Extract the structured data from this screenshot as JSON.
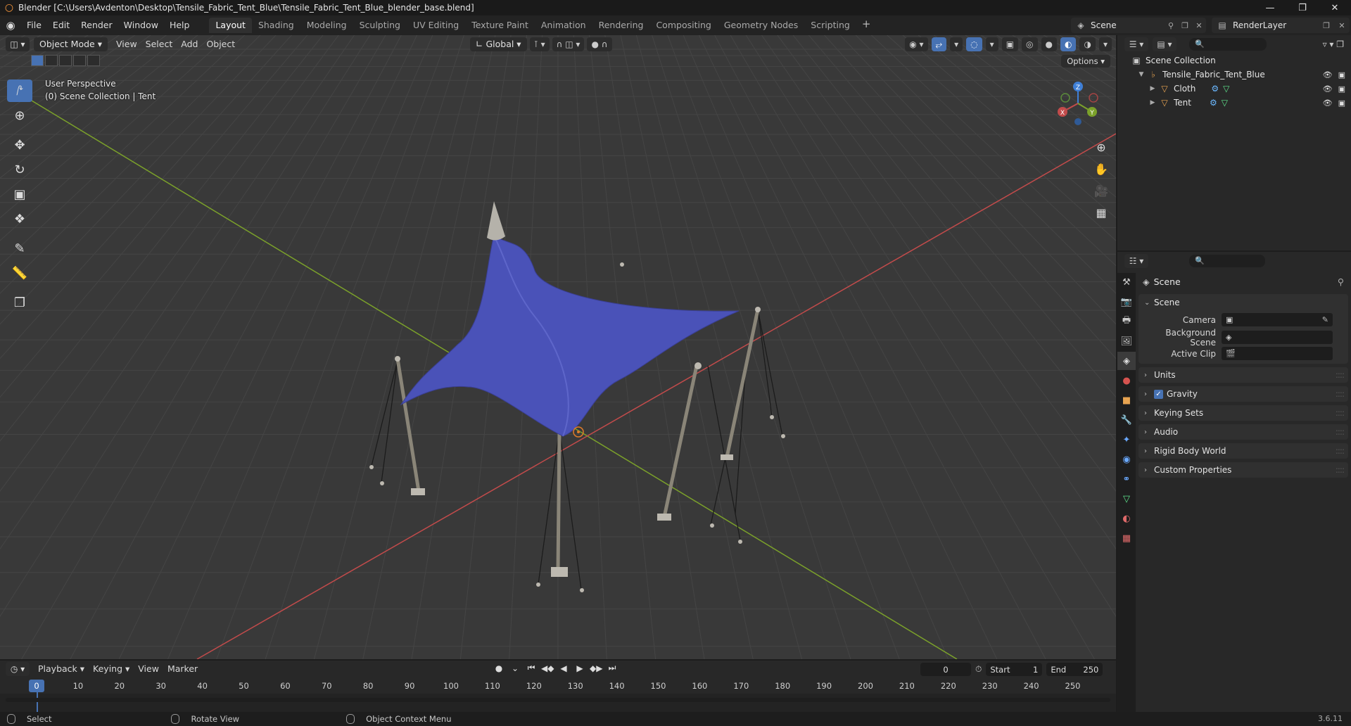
{
  "window": {
    "title": "Blender [C:\\Users\\Avdenton\\Desktop\\Tensile_Fabric_Tent_Blue\\Tensile_Fabric_Tent_Blue_blender_base.blend]",
    "minimize": "—",
    "maximize": "❐",
    "close": "✕"
  },
  "menu": [
    "File",
    "Edit",
    "Render",
    "Window",
    "Help"
  ],
  "workspaces": [
    "Layout",
    "Shading",
    "Modeling",
    "Sculpting",
    "UV Editing",
    "Texture Paint",
    "Animation",
    "Rendering",
    "Compositing",
    "Geometry Nodes",
    "Scripting"
  ],
  "active_workspace": "Layout",
  "workspace_add": "+",
  "scene_selector": {
    "name": "Scene"
  },
  "render_layer": {
    "name": "RenderLayer"
  },
  "viewport": {
    "mode": "Object Mode",
    "menus": [
      "View",
      "Select",
      "Add",
      "Object"
    ],
    "orientation": "Global",
    "options": "Options",
    "perspective": "User Perspective",
    "collection_info": "(0) Scene Collection | Tent",
    "gizmo": {
      "x": "X",
      "y": "Y",
      "z": "Z"
    }
  },
  "outliner": {
    "search_placeholder": "",
    "root": "Scene Collection",
    "collection": "Tensile_Fabric_Tent_Blue",
    "objects": [
      {
        "name": "Cloth"
      },
      {
        "name": "Tent"
      }
    ]
  },
  "properties": {
    "context": "Scene",
    "panel_title": "Scene",
    "fields": [
      {
        "label": "Camera",
        "value": ""
      },
      {
        "label": "Background Scene",
        "value": ""
      },
      {
        "label": "Active Clip",
        "value": ""
      }
    ],
    "subpanels": [
      {
        "label": "Units",
        "checkbox": false
      },
      {
        "label": "Gravity",
        "checkbox": true
      },
      {
        "label": "Keying Sets",
        "checkbox": false
      },
      {
        "label": "Audio",
        "checkbox": false
      },
      {
        "label": "Rigid Body World",
        "checkbox": false
      },
      {
        "label": "Custom Properties",
        "checkbox": false
      }
    ]
  },
  "timeline": {
    "menus": [
      "Playback",
      "Keying",
      "View",
      "Marker"
    ],
    "current_frame": "0",
    "start_label": "Start",
    "start": "1",
    "end_label": "End",
    "end": "250",
    "ticks": [
      "10",
      "20",
      "30",
      "40",
      "50",
      "60",
      "70",
      "80",
      "90",
      "100",
      "110",
      "120",
      "130",
      "140",
      "150",
      "160",
      "170",
      "180",
      "190",
      "200",
      "210",
      "220",
      "230",
      "240",
      "250"
    ],
    "playhead_label": "0"
  },
  "statusbar": {
    "items": [
      "Select",
      "Rotate View",
      "Object Context Menu"
    ],
    "version": "3.6.11"
  },
  "colors": {
    "accent": "#4772b3",
    "fabric": "#4a52b8",
    "x_axis": "#c24b4b",
    "y_axis": "#7ba12a",
    "z_axis": "#3f7fd6"
  }
}
